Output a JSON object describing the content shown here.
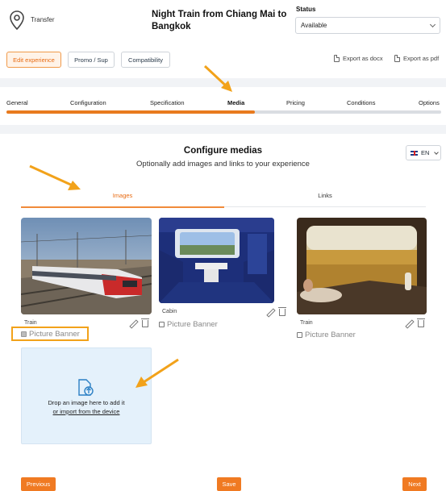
{
  "header": {
    "category": "Transfer",
    "title": "Night Train from Chiang Mai to Bangkok",
    "status_label": "Status",
    "status_value": "Available"
  },
  "actions": {
    "edit_experience": "Edit experience",
    "promo_sup": "Promo / Sup",
    "compatibility": "Compatibility",
    "export_docx": "Export as docx",
    "export_pdf": "Export as pdf"
  },
  "steps": [
    "General",
    "Configuration",
    "Specification",
    "Media",
    "Pricing",
    "Conditions",
    "Options"
  ],
  "current_step": "Media",
  "configure": {
    "title": "Configure medias",
    "subtitle": "Optionally add images and links to your experience",
    "language": "EN"
  },
  "tabs": {
    "images": "Images",
    "links": "Links"
  },
  "images": [
    {
      "caption": "Train",
      "banner_label": "Picture Banner",
      "banner_checked": true
    },
    {
      "caption": "Cabin",
      "banner_label": "Picture Banner",
      "banner_checked": false
    },
    {
      "caption": "Train",
      "banner_label": "Picture Banner",
      "banner_checked": false
    }
  ],
  "dropzone": {
    "line1": "Drop an image here to add it",
    "line2": "or import from the device"
  },
  "footer": {
    "previous": "Previous",
    "save": "Save",
    "next": "Next"
  },
  "colors": {
    "accent": "#e87a1e",
    "highlight": "#f2a21a"
  }
}
